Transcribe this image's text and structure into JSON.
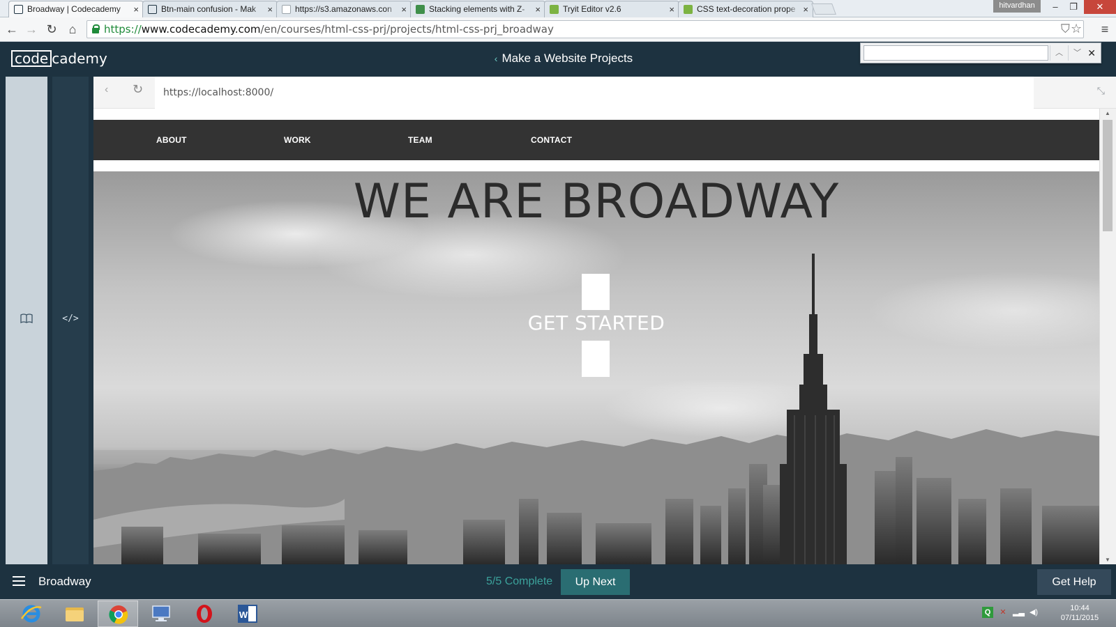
{
  "browser": {
    "tabs": [
      {
        "title": "Broadway | Codecademy",
        "favicon_color": "#1d3240",
        "active": true
      },
      {
        "title": "Btn-main confusion - Mak",
        "favicon_color": "#1d3240",
        "active": false
      },
      {
        "title": "https://s3.amazonaws.con",
        "favicon_color": "#9aa3aa",
        "active": false
      },
      {
        "title": "Stacking elements with Z-",
        "favicon_color": "#3f8f4a",
        "active": false
      },
      {
        "title": "Tryit Editor v2.6",
        "favicon_color": "#7cb342",
        "active": false
      },
      {
        "title": "CSS text-decoration prope",
        "favicon_color": "#7cb342",
        "active": false
      }
    ],
    "user_name": "hitvardhan",
    "window_controls": {
      "minimize": "–",
      "restore": "❐",
      "close": "✕"
    },
    "address": {
      "scheme": "https://",
      "host": "www.codecademy.com",
      "path": "/en/courses/html-css-prj/projects/html-css-prj_broadway"
    },
    "find_bar": {
      "query": ""
    }
  },
  "codecademy": {
    "logo_box": "code",
    "logo_rest": "cademy",
    "projects_link": "Make a Website Projects",
    "footer": {
      "project_name": "Broadway",
      "progress": "5/5 Complete",
      "up_next": "Up Next",
      "get_help": "Get Help"
    }
  },
  "preview": {
    "url": "https://localhost:8000/",
    "nav": [
      "ABOUT",
      "WORK",
      "TEAM",
      "CONTACT"
    ],
    "hero_title": "WE ARE BROADWAY",
    "cta": "GET STARTED"
  },
  "taskbar": {
    "apps": [
      "internet-explorer",
      "file-explorer",
      "chrome",
      "remote-desktop",
      "opera",
      "word"
    ],
    "time": "10:44",
    "date": "07/11/2015"
  },
  "colors": {
    "codecademy_navy": "#1d3240",
    "accent_teal": "#3ca39c",
    "up_next_bg": "#2a6d72",
    "site_nav_bg": "#333333"
  }
}
